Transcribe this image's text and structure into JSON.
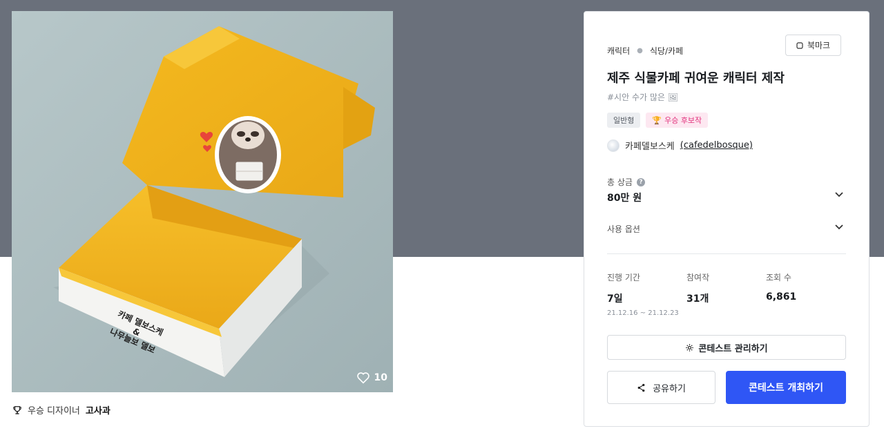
{
  "like_count": "10",
  "winner": {
    "prefix": "우승 디자이너",
    "name": "고사과"
  },
  "box_print": {
    "line1": "카페 델보스케",
    "line2": "&",
    "line3": "나무늘보 델보"
  },
  "breadcrumb": {
    "category": "캐릭터",
    "subcategory": "식당/카페"
  },
  "bookmark_label": "북마크",
  "contest": {
    "title": "제주 식물카페 귀여운 캐릭터 제작",
    "subtitle": "#시안 수가 많은 🖼",
    "tags": [
      "일반형",
      "우승 후보작"
    ],
    "host_name": "카페델보스케",
    "host_handle": "(cafedelbosque)"
  },
  "prize": {
    "label": "총 상금",
    "value": "80만 원"
  },
  "usage_label": "사용 옵션",
  "stats": {
    "period_label": "진행 기간",
    "period_value": "7일",
    "period_range": "21.12.16 ~ 21.12.23",
    "entries_label": "참여작",
    "entries_value": "31개",
    "views_label": "조회 수",
    "views_value": "6,861"
  },
  "buttons": {
    "manage": "콘테스트 관리하기",
    "share": "공유하기",
    "host": "콘테스트 개최하기"
  },
  "colors": {
    "header_band": "#6a707b",
    "primary": "#2f56f5",
    "box_yellow": "#f2b51d",
    "tag_pink": "#e2337d"
  }
}
